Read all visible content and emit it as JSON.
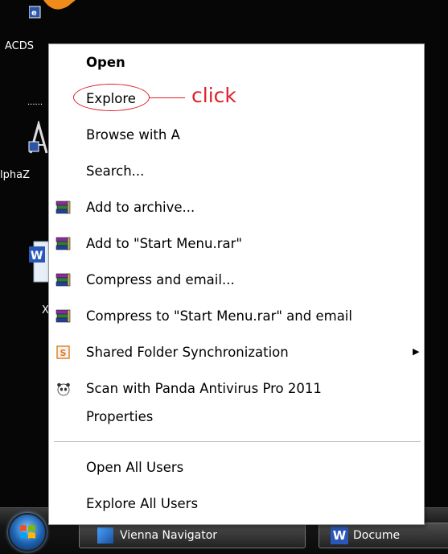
{
  "desktop": {
    "labels": [
      "ACDS",
      "......",
      "lphaZ",
      "X"
    ]
  },
  "menu": {
    "items": [
      {
        "label": "Open",
        "icon": "none",
        "bold": true
      },
      {
        "label": "Explore",
        "icon": "none"
      },
      {
        "label": "Browse with A",
        "icon": "none"
      },
      {
        "label": "Search...",
        "icon": "none"
      },
      {
        "label": "Add to archive...",
        "icon": "winrar-books-icon"
      },
      {
        "label": "Add to \"Start Menu.rar\"",
        "icon": "winrar-books-icon"
      },
      {
        "label": "Compress and email...",
        "icon": "winrar-books-icon"
      },
      {
        "label": "Compress to \"Start Menu.rar\" and email",
        "icon": "winrar-books-icon"
      },
      {
        "label": "Shared Folder Synchronization",
        "icon": "shared-folder-sync-icon",
        "submenu": true
      },
      {
        "label": "Scan with Panda Antivirus Pro 2011",
        "icon": "panda-icon"
      },
      {
        "label": "Properties",
        "icon": "none"
      },
      {
        "label": "Open All Users",
        "icon": "none"
      },
      {
        "label": "Explore All Users",
        "icon": "none"
      }
    ],
    "submenu_arrow": "▶"
  },
  "annotation": {
    "text": "click",
    "color": "#e0202a"
  },
  "taskbar": {
    "buttons": [
      {
        "label": "Vienna Navigator"
      },
      {
        "label": "Docume"
      }
    ]
  }
}
